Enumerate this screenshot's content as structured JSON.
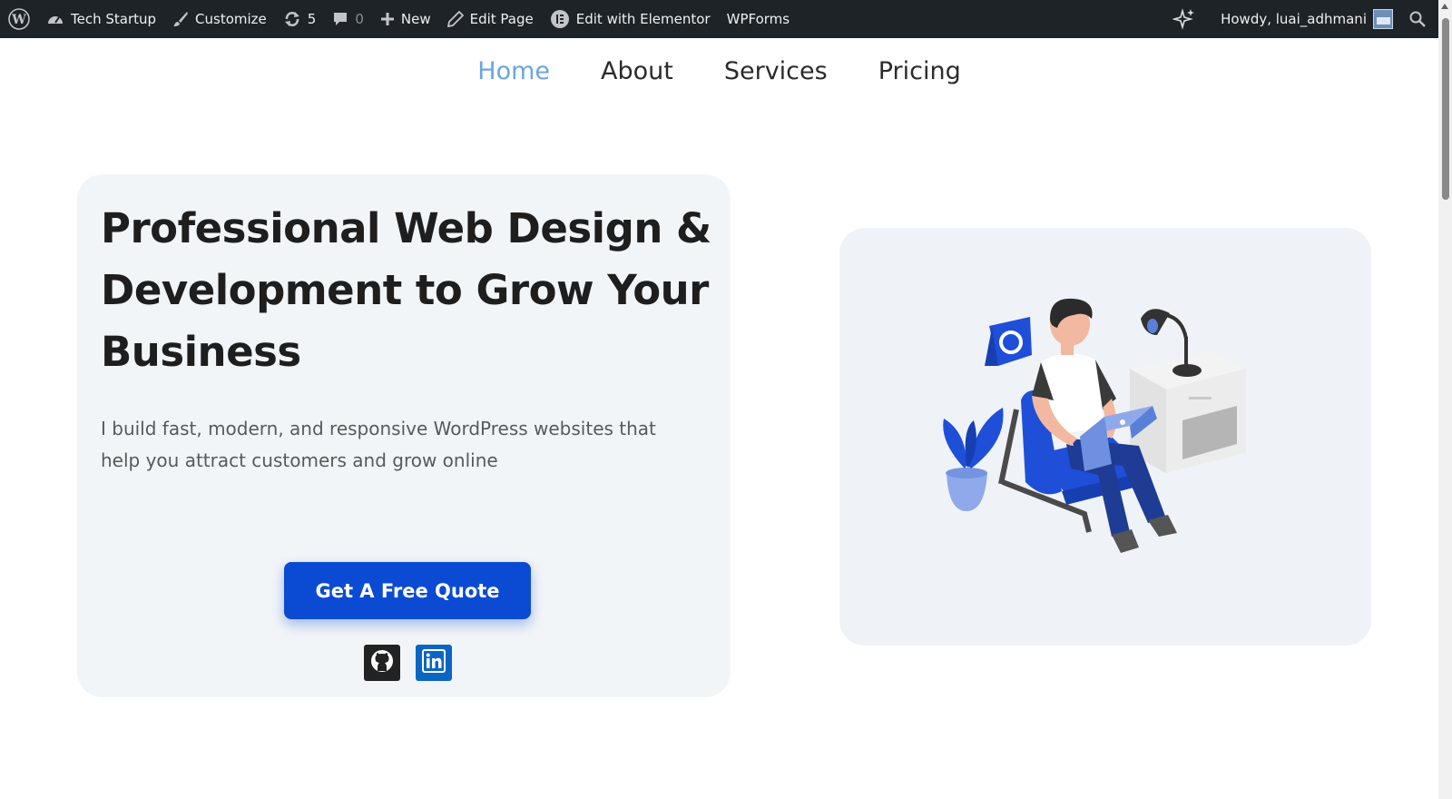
{
  "adminbar": {
    "site_name": "Tech Startup",
    "customize": "Customize",
    "updates_count": "5",
    "comments_count": "0",
    "new_label": "New",
    "edit_page": "Edit Page",
    "elementor": "Edit with Elementor",
    "wpforms": "WPForms",
    "howdy": "Howdy, luai_adhmani",
    "icons": [
      "wordpress-logo-icon",
      "dashboard-icon",
      "brush-icon",
      "updates-icon",
      "comment-icon",
      "plus-icon",
      "pencil-icon",
      "elementor-icon",
      "sparkle-icon",
      "avatar",
      "search-icon"
    ]
  },
  "nav": {
    "items": [
      {
        "label": "Home",
        "active": true
      },
      {
        "label": "About",
        "active": false
      },
      {
        "label": "Services",
        "active": false
      },
      {
        "label": "Pricing",
        "active": false
      }
    ],
    "active_color": "#6aa6e0"
  },
  "hero": {
    "title": "Professional Web Design & Development to Grow Your Business",
    "description": "I build fast, modern, and responsive WordPress websites that help you attract customers and grow online",
    "cta_label": "Get A Free Quote",
    "cta_color": "#0b4bd3",
    "social": [
      "github-icon",
      "linkedin-icon"
    ]
  },
  "illustration": {
    "subject": "man-with-laptop-in-armchair",
    "accent": "#1f4fd8"
  }
}
